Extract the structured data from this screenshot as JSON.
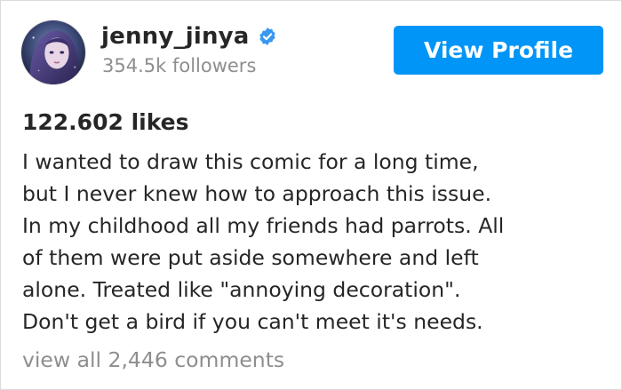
{
  "post": {
    "user": {
      "username": "jenny_jinya",
      "followers": "354.5k followers",
      "avatar_icon": "illustrated-portrait-avatar",
      "verified_icon": "verified-badge-icon"
    },
    "view_profile_label": "View Profile",
    "likes": "122.602 likes",
    "caption_lines": [
      "I wanted to draw this comic for a long time,",
      "but I never knew how to approach this issue.",
      "In my childhood all my friends had parrots. All",
      "of them were put aside somewhere and left",
      "alone. Treated like \"annoying decoration\".",
      "Don't get a bird if you can't meet it's needs."
    ],
    "view_comments": "view all 2,446 comments"
  },
  "colors": {
    "accent": "#0095f6",
    "text": "#262626",
    "muted": "#8e8e8e",
    "border": "#dbdbdb"
  }
}
